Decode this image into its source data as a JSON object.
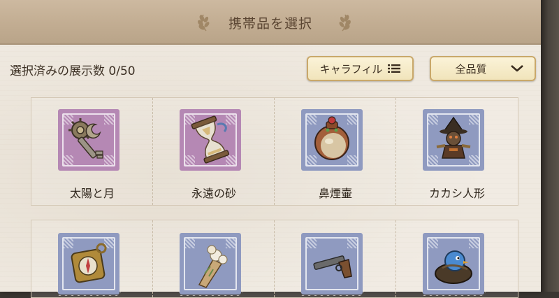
{
  "header": {
    "title": "携帯品を選択"
  },
  "selection": {
    "label": "選択済みの展示数 0/50"
  },
  "buttons": {
    "filter_label": "キャラフィル",
    "quality_label": "全品質"
  },
  "items_row1": [
    {
      "name": "太陽と月",
      "frame": "purple",
      "icon": "key-icon"
    },
    {
      "name": "永遠の砂",
      "frame": "purple",
      "icon": "hourglass-icon"
    },
    {
      "name": "鼻煙壷",
      "frame": "blue",
      "icon": "snuff-bottle-icon"
    },
    {
      "name": "カカシ人形",
      "frame": "blue",
      "icon": "scarecrow-doll-icon"
    }
  ],
  "items_row2": [
    {
      "name": "",
      "frame": "blue",
      "icon": "compass-icon"
    },
    {
      "name": "",
      "frame": "blue",
      "icon": "bouquet-icon"
    },
    {
      "name": "",
      "frame": "blue",
      "icon": "pistol-icon"
    },
    {
      "name": "",
      "frame": "blue",
      "icon": "bird-nest-icon"
    }
  ],
  "colors": {
    "header_bg": "#c2ad92",
    "panel_bg": "#efe9e0",
    "button_bg": "#f1e4bb",
    "button_border": "#c9a86a",
    "stamp_purple": "#b588b4",
    "stamp_blue": "#8f9ac0"
  }
}
